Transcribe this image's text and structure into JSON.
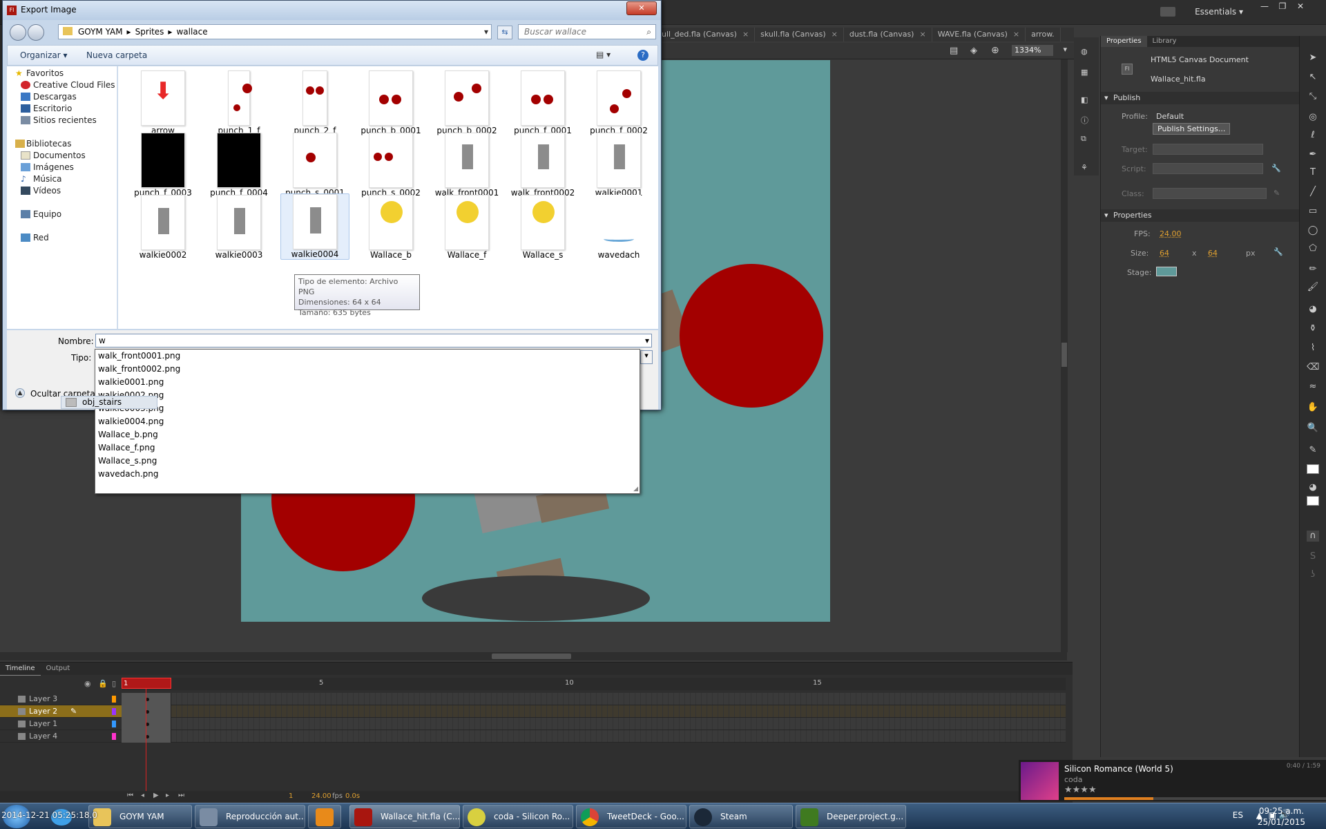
{
  "app": {
    "workspace": "Essentials"
  },
  "doc_tabs": [
    {
      "label": "ull_ded.fla (Canvas)"
    },
    {
      "label": "skull.fla (Canvas)"
    },
    {
      "label": "dust.fla (Canvas)"
    },
    {
      "label": "WAVE.fla (Canvas)"
    },
    {
      "label": "arrow."
    }
  ],
  "editbar": {
    "zoom": "1334%"
  },
  "timeline": {
    "tabs": [
      "Timeline",
      "Output"
    ],
    "layers": [
      {
        "name": "Layer 3",
        "color": "#ff9900"
      },
      {
        "name": "Layer 2",
        "color": "#9933ff"
      },
      {
        "name": "Layer 1",
        "color": "#3399ff"
      },
      {
        "name": "Layer 4",
        "color": "#ff33cc"
      }
    ],
    "ruler": [
      "1",
      "5",
      "10",
      "15"
    ],
    "current_frame": "1",
    "fps": "24.00",
    "fps_unit": "fps",
    "time": "0.0s"
  },
  "properties": {
    "tabs": [
      "Properties",
      "Library"
    ],
    "doc_type": "HTML5 Canvas Document",
    "doc_name": "Wallace_hit.fla",
    "publish_header": "Publish",
    "profile_label": "Profile:",
    "profile_value": "Default",
    "publish_settings_btn": "Publish Settings...",
    "target_label": "Target:",
    "script_label": "Script:",
    "class_label": "Class:",
    "props_header": "Properties",
    "fps_label": "FPS:",
    "fps_value": "24.00",
    "size_label": "Size:",
    "width": "64",
    "x": "x",
    "height": "64",
    "unit": "px",
    "stage_label": "Stage:",
    "stage_color": "#5f9a9a"
  },
  "music": {
    "title": "Silicon Romance (World 5)",
    "artist": "coda",
    "time": "0:40 / 1:59"
  },
  "dialog": {
    "title": "Export Image",
    "breadcrumbs": [
      "GOYM YAM",
      "Sprites",
      "wallace"
    ],
    "search_placeholder": "Buscar wallace",
    "organize": "Organizar",
    "new_folder": "Nueva carpeta",
    "nav": [
      {
        "label": "Favoritos",
        "group": true
      },
      {
        "label": "Creative Cloud Files"
      },
      {
        "label": "Descargas"
      },
      {
        "label": "Escritorio"
      },
      {
        "label": "Sitios recientes"
      },
      {
        "label": "Bibliotecas",
        "group": true
      },
      {
        "label": "Documentos"
      },
      {
        "label": "Imágenes"
      },
      {
        "label": "Música"
      },
      {
        "label": "Vídeos"
      },
      {
        "label": "Equipo",
        "group": true
      },
      {
        "label": "Red",
        "group": true
      }
    ],
    "files": [
      "arrow",
      "punch_1_f",
      "punch_2_f",
      "punch_b_0001",
      "punch_b_0002",
      "punch_f_0001",
      "punch_f_0002",
      "punch_f_0003",
      "punch_f_0004",
      "punch_s_0001",
      "punch_s_0002",
      "walk_front0001",
      "walk_front0002",
      "walkie0001",
      "walkie0002",
      "walkie0003",
      "walkie0004",
      "Wallace_b",
      "Wallace_f",
      "Wallace_s",
      "wavedach"
    ],
    "tooltip": {
      "type": "Tipo de elemento: Archivo PNG",
      "dims": "Dimensiones: 64 x 64",
      "size": "Tamaño: 635 bytes"
    },
    "name_label": "Nombre:",
    "name_value": "w",
    "type_label": "Tipo:",
    "hide_folders": "Ocultar carpetas",
    "autocomplete": [
      "walk_front0001.png",
      "walk_front0002.png",
      "walkie0001.png",
      "walkie0002.png",
      "walkie0003.png",
      "walkie0004.png",
      "Wallace_b.png",
      "Wallace_f.png",
      "Wallace_s.png",
      "wavedach.png"
    ],
    "drag_item": "obj_stairs"
  },
  "taskbar": {
    "items": [
      "GOYM YAM",
      "Reproducción aut...",
      "",
      "Wallace_hit.fla (C...",
      "coda - Silicon Ro...",
      "TweetDeck - Goo...",
      "Steam",
      "Deeper.project.g..."
    ],
    "overlay": "2014-12-21 05:25:18.0",
    "lang": "ES",
    "time": "09:25 a.m.",
    "date": "25/01/2015"
  }
}
